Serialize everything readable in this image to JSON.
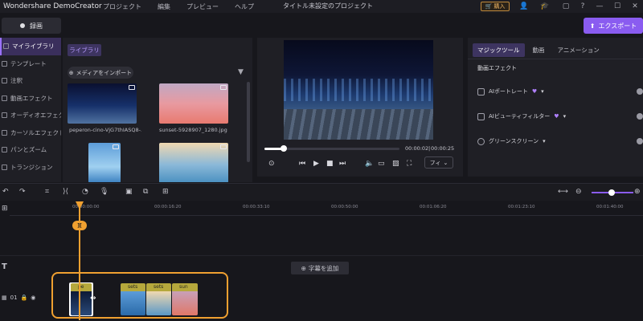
{
  "titlebar": {
    "app_name": "Wondershare DemoCreator",
    "menu": [
      "プロジェクト",
      "編集",
      "プレビュー",
      "ヘルプ"
    ],
    "project_title": "タイトル未設定のプロジェクト",
    "purchase_label": "購入"
  },
  "toolbar": {
    "record_label": "録画",
    "export_label": "エクスポート"
  },
  "sidebar": {
    "items": [
      {
        "label": "マイライブラリ"
      },
      {
        "label": "テンプレート"
      },
      {
        "label": "注釈"
      },
      {
        "label": "動画エフェクト"
      },
      {
        "label": "オーディオエフェクト"
      },
      {
        "label": "カーソルエフェクト"
      },
      {
        "label": "パンとズーム"
      },
      {
        "label": "トランジション"
      }
    ]
  },
  "media": {
    "library_tab": "ライブラリ",
    "import_label": "メディアをインポート",
    "items": [
      {
        "name": "peperon-cino-VjG7thIASQ8-..."
      },
      {
        "name": "sunset-5928907_1280.jpg"
      },
      {
        "name": ""
      },
      {
        "name": ""
      }
    ]
  },
  "preview": {
    "current_time": "00:00:02",
    "total_time": "00:00:25",
    "progress_fraction": 0.14,
    "quality_label": "フィ"
  },
  "right_panel": {
    "tabs": [
      "マジックツール",
      "動画",
      "アニメーション"
    ],
    "heading": "動画エフェクト",
    "effects": [
      {
        "label": "AIポートレート"
      },
      {
        "label": "AIビューティフィルター"
      },
      {
        "label": "グリーンスクリーン"
      }
    ]
  },
  "timeline": {
    "ticks": [
      "00:00:00:00",
      "00:00:16:20",
      "00:00:33:10",
      "00:00:50:00",
      "00:01:06:20",
      "00:01:23:10",
      "00:01:40:00"
    ],
    "playhead_tag": "][",
    "add_subtitle_label": "字幕を追加",
    "track_number": "01",
    "clip_labels": [
      "pe",
      "sets",
      "sets",
      "sun"
    ]
  },
  "colors": {
    "accent": "#8a5cf0",
    "playhead": "#f0a030",
    "clip_header": "#b5a83c"
  }
}
